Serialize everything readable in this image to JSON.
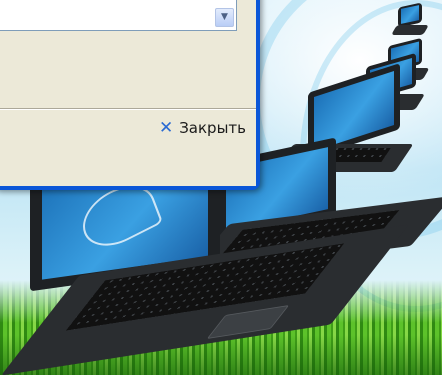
{
  "dialog": {
    "close_label": "Закрыть",
    "close_icon": "close-icon"
  },
  "colors": {
    "window_frame": "#0a56d8",
    "window_body": "#ece9d8",
    "close_x": "#2a6ad2"
  }
}
